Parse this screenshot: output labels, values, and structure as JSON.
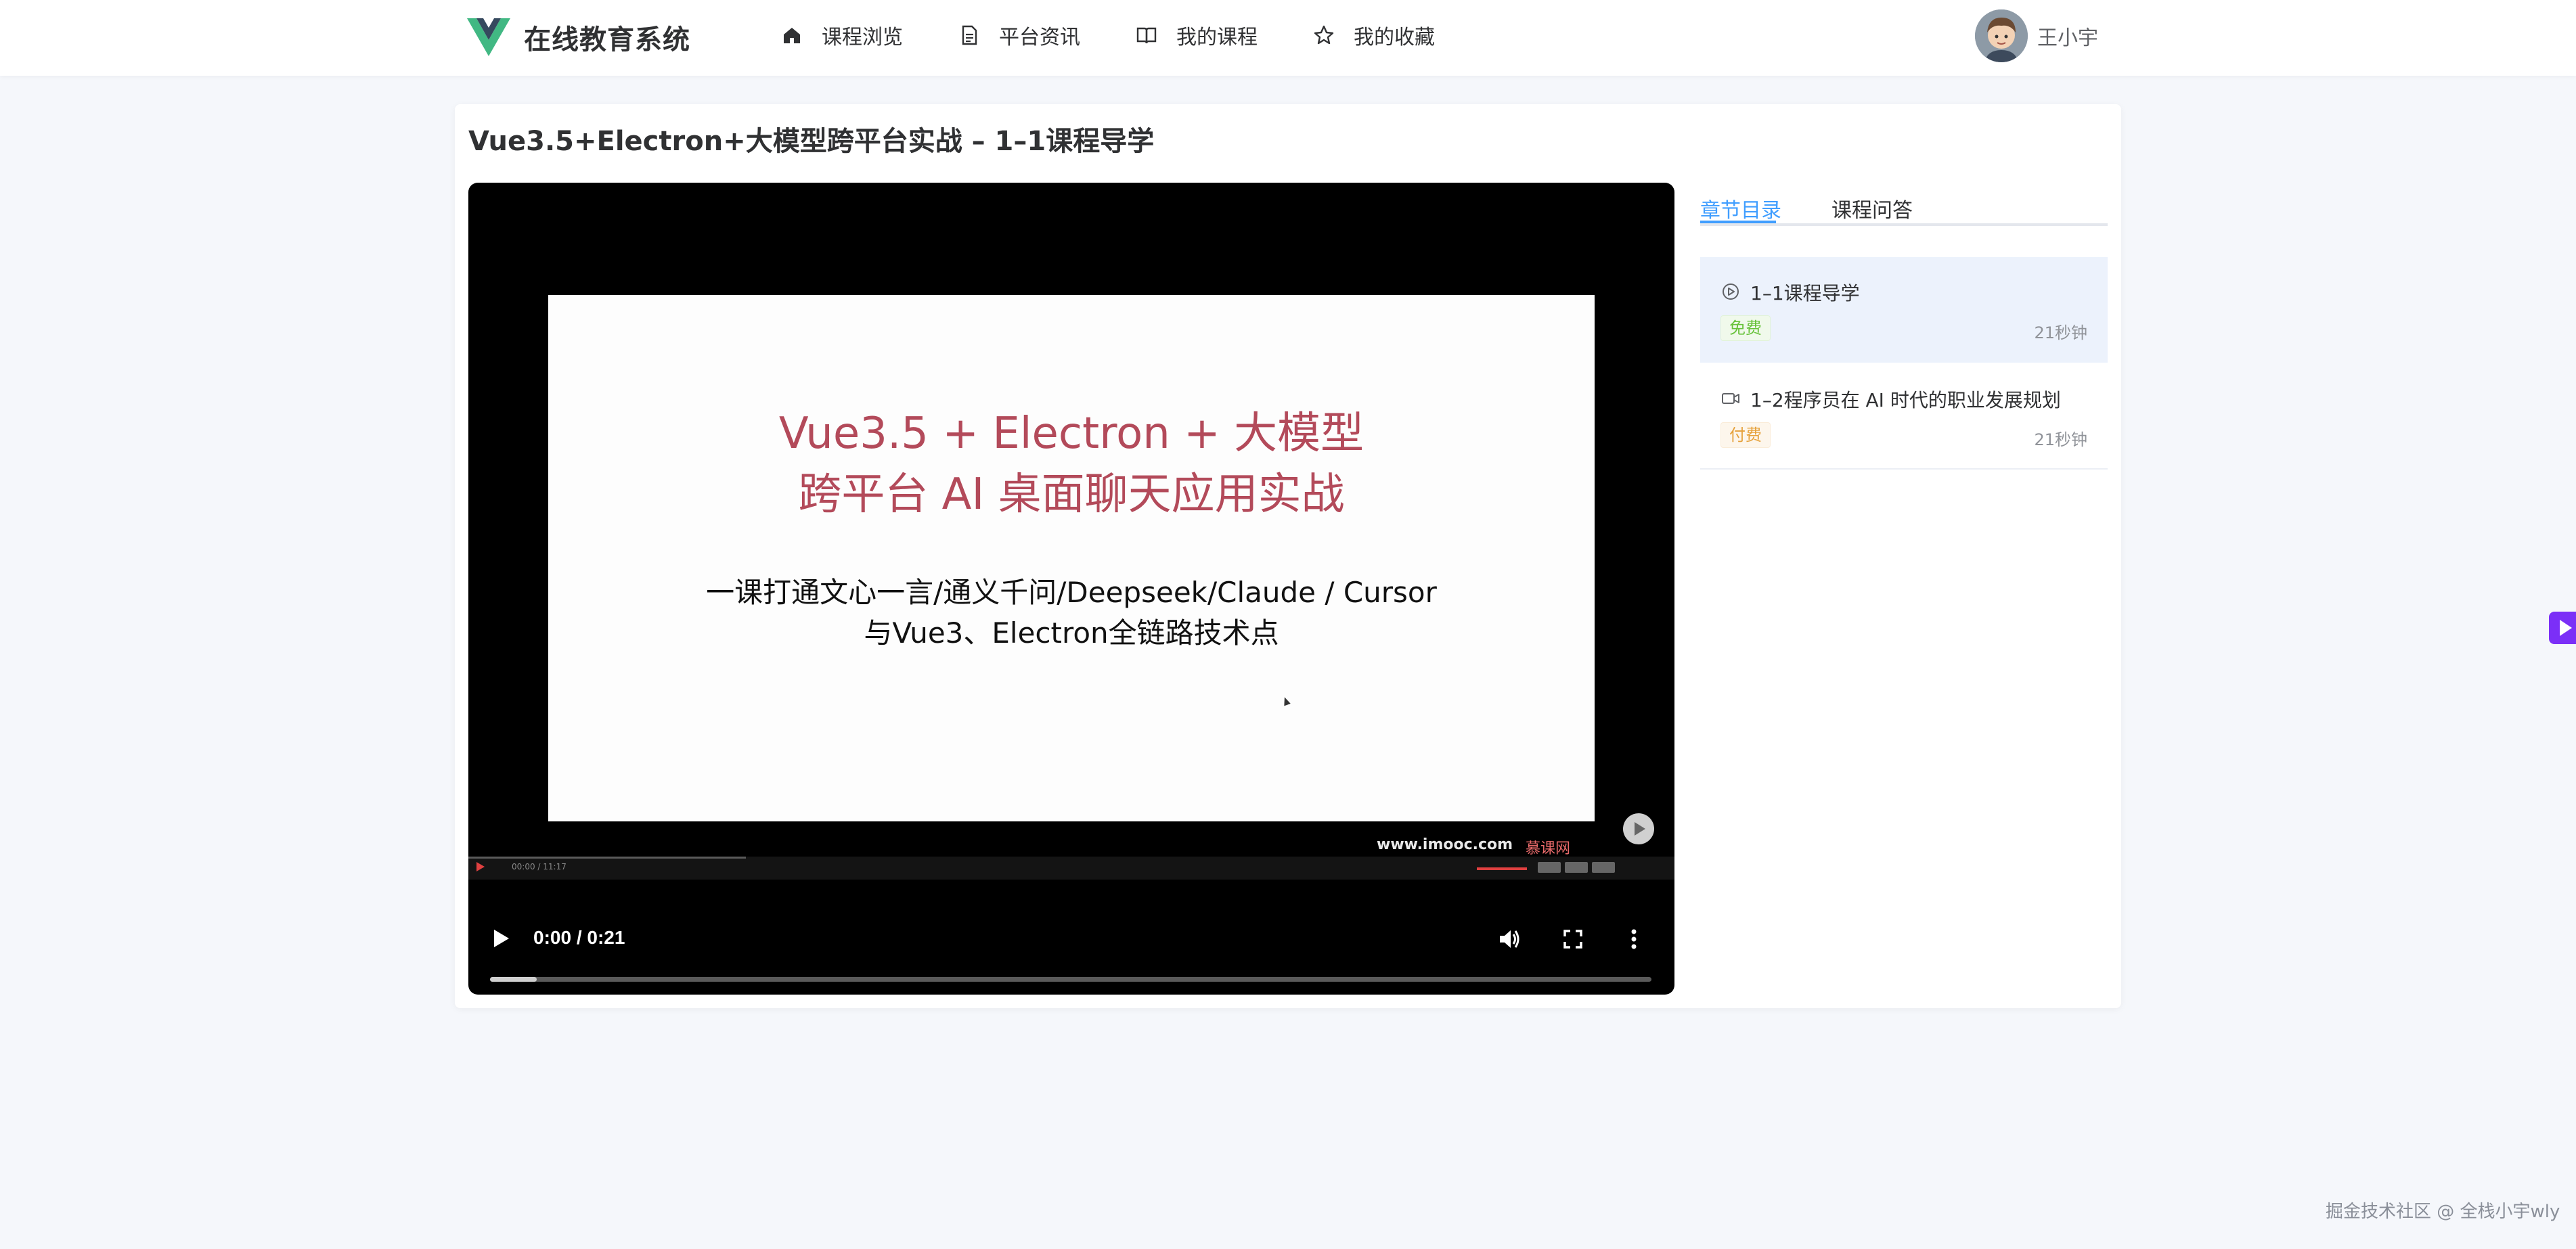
{
  "header": {
    "logo_text": "在线教育系统",
    "nav": [
      {
        "label": "课程浏览",
        "icon": "home-icon"
      },
      {
        "label": "平台资讯",
        "icon": "document-icon"
      },
      {
        "label": "我的课程",
        "icon": "book-icon"
      },
      {
        "label": "我的收藏",
        "icon": "star-icon"
      }
    ],
    "user": {
      "name": "王小宇"
    }
  },
  "page": {
    "title": "Vue3.5+Electron+大模型跨平台实战 – 1–1课程导学"
  },
  "video": {
    "slide": {
      "title_line1": "Vue3.5 + Electron + 大模型",
      "title_line2": "跨平台 AI 桌面聊天应用实战",
      "sub_line1": "一课打通文心一言/通义千问/Deepseek/Claude / Cursor",
      "sub_line2": "与Vue3、Electron全链路技术点",
      "watermark_site": "www.imooc.com",
      "watermark_brand": "慕课网",
      "inner_time": "00:00 / 11:17"
    },
    "time": "0:00 / 0:21",
    "progress": 0.04
  },
  "sidebar": {
    "tabs": [
      {
        "label": "章节目录",
        "active": true
      },
      {
        "label": "课程问答",
        "active": false
      }
    ],
    "chapters": [
      {
        "title": "1–1课程导学",
        "badge": "免费",
        "duration": "21秒钟",
        "icon": "play-circle-icon"
      },
      {
        "title": "1–2程序员在 AI 时代的职业发展规划",
        "badge": "付费",
        "duration": "21秒钟",
        "icon": "video-camera-icon"
      }
    ]
  },
  "footer": {
    "watermark": "掘金技术社区 @ 全栈小宇wly"
  },
  "colors": {
    "accent": "#409eff",
    "free": "#67c23a",
    "paid": "#e6a23c",
    "slide_title": "#b34a5a"
  }
}
